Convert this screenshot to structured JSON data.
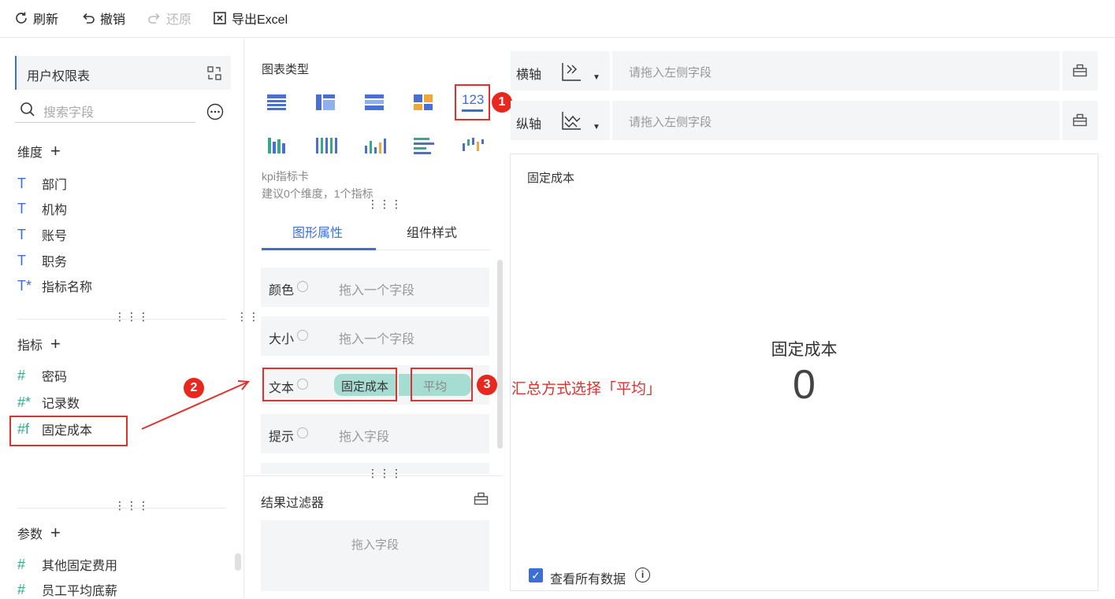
{
  "toolbar": {
    "refresh": "刷新",
    "undo": "撤销",
    "redo": "还原",
    "export": "导出Excel"
  },
  "left": {
    "table_name": "用户权限表",
    "search_placeholder": "搜索字段",
    "dimensions_title": "维度",
    "dimensions": [
      {
        "icon": "T",
        "label": "部门"
      },
      {
        "icon": "T",
        "label": "机构"
      },
      {
        "icon": "T",
        "label": "账号"
      },
      {
        "icon": "T",
        "label": "职务"
      },
      {
        "icon": "T*",
        "label": "指标名称"
      }
    ],
    "measures_title": "指标",
    "measures": [
      {
        "icon": "#",
        "label": "密码"
      },
      {
        "icon": "#*",
        "label": "记录数"
      },
      {
        "icon": "#f",
        "label": "固定成本"
      }
    ],
    "params_title": "参数",
    "params": [
      {
        "icon": "#",
        "label": "其他固定费用"
      },
      {
        "icon": "#",
        "label": "员工平均底薪"
      }
    ]
  },
  "middle": {
    "chart_type_title": "图表类型",
    "kpi_icon_text": "123",
    "chart_desc_name": "kpi指标卡",
    "chart_desc_hint": "建议0个维度，1个指标",
    "tabs": [
      "图形属性",
      "组件样式"
    ],
    "props": [
      {
        "label": "颜色",
        "placeholder": "拖入一个字段"
      },
      {
        "label": "大小",
        "placeholder": "拖入一个字段"
      },
      {
        "label": "文本",
        "field": "固定成本",
        "agg": "平均"
      },
      {
        "label": "提示",
        "placeholder": "拖入字段"
      }
    ],
    "filter_title": "结果过滤器",
    "filter_placeholder": "拖入字段"
  },
  "annotations": {
    "badge1": "1",
    "badge2": "2",
    "badge3": "3",
    "note": "汇总方式选择「平均」"
  },
  "right": {
    "x_axis_label": "横轴",
    "y_axis_label": "纵轴",
    "axis_placeholder": "请拖入左侧字段",
    "card_title": "固定成本",
    "kpi_name": "固定成本",
    "kpi_value": "0",
    "view_all_label": "查看所有数据"
  },
  "colors": {
    "accent": "#3b6fd6",
    "annotation": "#e03131",
    "pill": "#a6ddd3"
  }
}
